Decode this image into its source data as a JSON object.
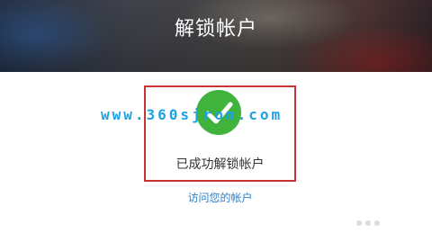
{
  "header": {
    "title": "解锁帐户"
  },
  "status": {
    "icon": "checkmark-icon",
    "color": "#3fb33c",
    "message": "已成功解锁帐户"
  },
  "watermark": {
    "text": "www.360sjrom.com",
    "color": "#1da1e0"
  },
  "links": {
    "visit_account": "访问您的帐户",
    "color": "#2c7fc9"
  },
  "annotation": {
    "box_color": "#c83232"
  }
}
